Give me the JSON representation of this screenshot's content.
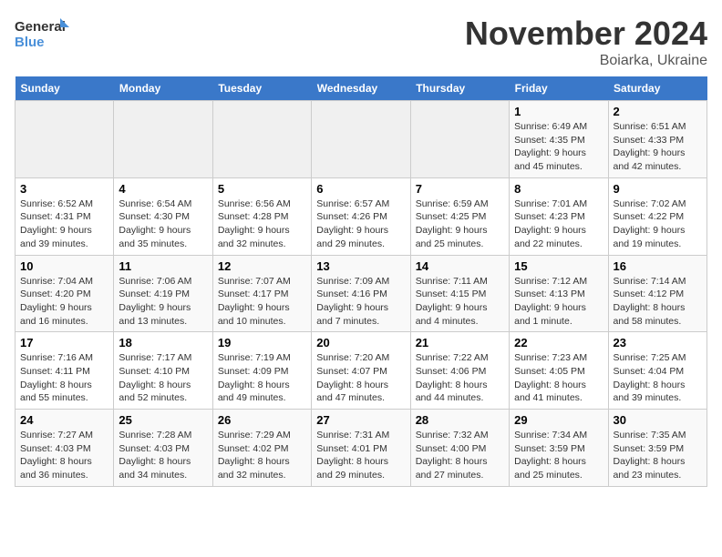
{
  "logo": {
    "line1": "General",
    "line2": "Blue"
  },
  "title": "November 2024",
  "subtitle": "Boiarka, Ukraine",
  "days_of_week": [
    "Sunday",
    "Monday",
    "Tuesday",
    "Wednesday",
    "Thursday",
    "Friday",
    "Saturday"
  ],
  "weeks": [
    [
      {
        "day": "",
        "info": ""
      },
      {
        "day": "",
        "info": ""
      },
      {
        "day": "",
        "info": ""
      },
      {
        "day": "",
        "info": ""
      },
      {
        "day": "",
        "info": ""
      },
      {
        "day": "1",
        "info": "Sunrise: 6:49 AM\nSunset: 4:35 PM\nDaylight: 9 hours and 45 minutes."
      },
      {
        "day": "2",
        "info": "Sunrise: 6:51 AM\nSunset: 4:33 PM\nDaylight: 9 hours and 42 minutes."
      }
    ],
    [
      {
        "day": "3",
        "info": "Sunrise: 6:52 AM\nSunset: 4:31 PM\nDaylight: 9 hours and 39 minutes."
      },
      {
        "day": "4",
        "info": "Sunrise: 6:54 AM\nSunset: 4:30 PM\nDaylight: 9 hours and 35 minutes."
      },
      {
        "day": "5",
        "info": "Sunrise: 6:56 AM\nSunset: 4:28 PM\nDaylight: 9 hours and 32 minutes."
      },
      {
        "day": "6",
        "info": "Sunrise: 6:57 AM\nSunset: 4:26 PM\nDaylight: 9 hours and 29 minutes."
      },
      {
        "day": "7",
        "info": "Sunrise: 6:59 AM\nSunset: 4:25 PM\nDaylight: 9 hours and 25 minutes."
      },
      {
        "day": "8",
        "info": "Sunrise: 7:01 AM\nSunset: 4:23 PM\nDaylight: 9 hours and 22 minutes."
      },
      {
        "day": "9",
        "info": "Sunrise: 7:02 AM\nSunset: 4:22 PM\nDaylight: 9 hours and 19 minutes."
      }
    ],
    [
      {
        "day": "10",
        "info": "Sunrise: 7:04 AM\nSunset: 4:20 PM\nDaylight: 9 hours and 16 minutes."
      },
      {
        "day": "11",
        "info": "Sunrise: 7:06 AM\nSunset: 4:19 PM\nDaylight: 9 hours and 13 minutes."
      },
      {
        "day": "12",
        "info": "Sunrise: 7:07 AM\nSunset: 4:17 PM\nDaylight: 9 hours and 10 minutes."
      },
      {
        "day": "13",
        "info": "Sunrise: 7:09 AM\nSunset: 4:16 PM\nDaylight: 9 hours and 7 minutes."
      },
      {
        "day": "14",
        "info": "Sunrise: 7:11 AM\nSunset: 4:15 PM\nDaylight: 9 hours and 4 minutes."
      },
      {
        "day": "15",
        "info": "Sunrise: 7:12 AM\nSunset: 4:13 PM\nDaylight: 9 hours and 1 minute."
      },
      {
        "day": "16",
        "info": "Sunrise: 7:14 AM\nSunset: 4:12 PM\nDaylight: 8 hours and 58 minutes."
      }
    ],
    [
      {
        "day": "17",
        "info": "Sunrise: 7:16 AM\nSunset: 4:11 PM\nDaylight: 8 hours and 55 minutes."
      },
      {
        "day": "18",
        "info": "Sunrise: 7:17 AM\nSunset: 4:10 PM\nDaylight: 8 hours and 52 minutes."
      },
      {
        "day": "19",
        "info": "Sunrise: 7:19 AM\nSunset: 4:09 PM\nDaylight: 8 hours and 49 minutes."
      },
      {
        "day": "20",
        "info": "Sunrise: 7:20 AM\nSunset: 4:07 PM\nDaylight: 8 hours and 47 minutes."
      },
      {
        "day": "21",
        "info": "Sunrise: 7:22 AM\nSunset: 4:06 PM\nDaylight: 8 hours and 44 minutes."
      },
      {
        "day": "22",
        "info": "Sunrise: 7:23 AM\nSunset: 4:05 PM\nDaylight: 8 hours and 41 minutes."
      },
      {
        "day": "23",
        "info": "Sunrise: 7:25 AM\nSunset: 4:04 PM\nDaylight: 8 hours and 39 minutes."
      }
    ],
    [
      {
        "day": "24",
        "info": "Sunrise: 7:27 AM\nSunset: 4:03 PM\nDaylight: 8 hours and 36 minutes."
      },
      {
        "day": "25",
        "info": "Sunrise: 7:28 AM\nSunset: 4:03 PM\nDaylight: 8 hours and 34 minutes."
      },
      {
        "day": "26",
        "info": "Sunrise: 7:29 AM\nSunset: 4:02 PM\nDaylight: 8 hours and 32 minutes."
      },
      {
        "day": "27",
        "info": "Sunrise: 7:31 AM\nSunset: 4:01 PM\nDaylight: 8 hours and 29 minutes."
      },
      {
        "day": "28",
        "info": "Sunrise: 7:32 AM\nSunset: 4:00 PM\nDaylight: 8 hours and 27 minutes."
      },
      {
        "day": "29",
        "info": "Sunrise: 7:34 AM\nSunset: 3:59 PM\nDaylight: 8 hours and 25 minutes."
      },
      {
        "day": "30",
        "info": "Sunrise: 7:35 AM\nSunset: 3:59 PM\nDaylight: 8 hours and 23 minutes."
      }
    ]
  ]
}
